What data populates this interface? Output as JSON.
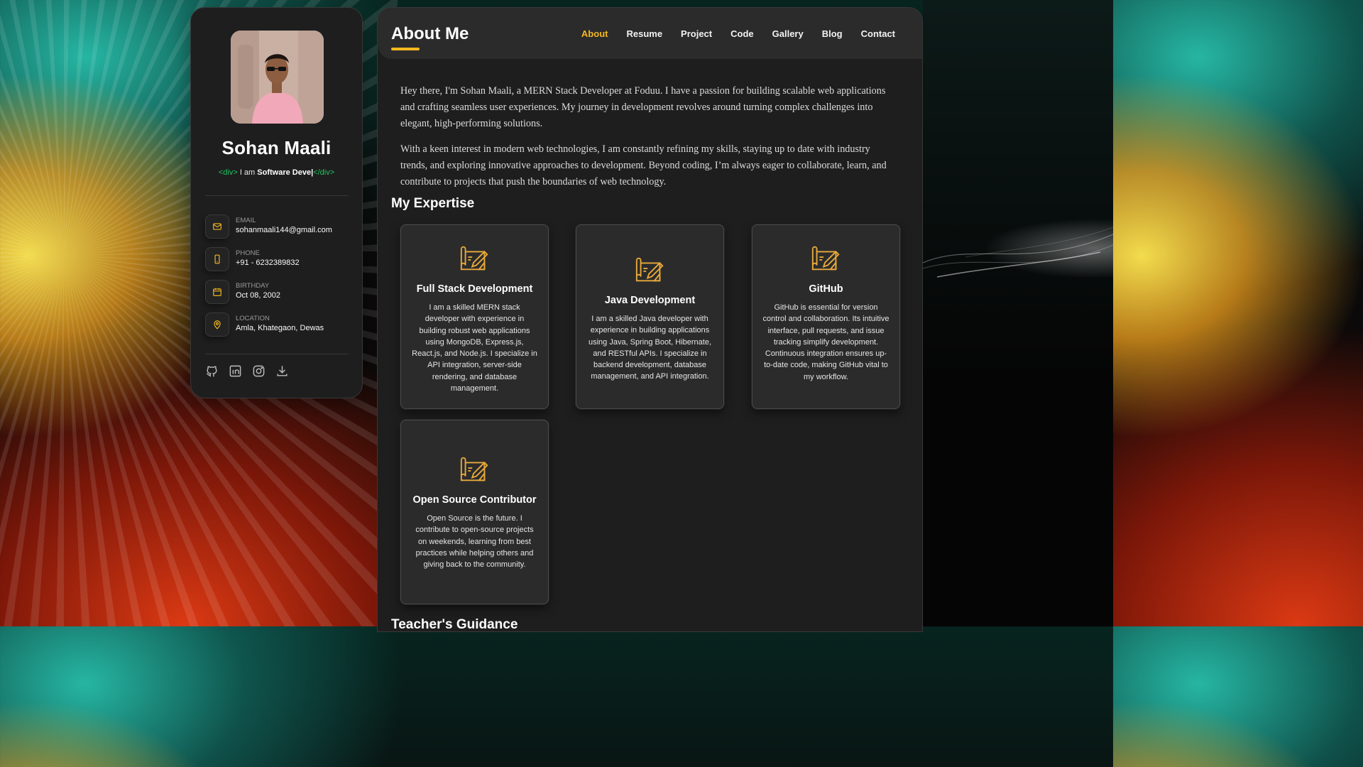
{
  "profile": {
    "name": "Sohan Maali",
    "tagline_open": "<div>",
    "tagline_prefix": " I am ",
    "tagline_role": "Software Deve|",
    "tagline_close": "</div>"
  },
  "contacts": [
    {
      "label": "EMAIL",
      "value": "sohanmaali144@gmail.com",
      "icon": "mail-icon"
    },
    {
      "label": "PHONE",
      "value": "+91 - 6232389832",
      "icon": "phone-icon"
    },
    {
      "label": "BIRTHDAY",
      "value": "Oct 08, 2002",
      "icon": "calendar-icon"
    },
    {
      "label": "LOCATION",
      "value": "Amla, Khategaon, Dewas",
      "icon": "location-pin-icon"
    }
  ],
  "socials": [
    "github-icon",
    "linkedin-icon",
    "instagram-icon",
    "download-icon"
  ],
  "header": {
    "title": "About Me",
    "nav": [
      "About",
      "Resume",
      "Project",
      "Code",
      "Gallery",
      "Blog",
      "Contact"
    ],
    "active": "About"
  },
  "about": {
    "p1": "Hey there, I'm Sohan Maali, a MERN Stack Developer at Foduu. I have a passion for building scalable web applications and crafting seamless user experiences. My journey in development revolves around turning complex challenges into elegant, high-performing solutions.",
    "p2": "With a keen interest in modern web technologies, I am constantly refining my skills, staying up to date with industry trends, and exploring innovative approaches to development. Beyond coding, I’m always eager to collaborate, learn, and contribute to projects that push the boundaries of web technology."
  },
  "expertise": {
    "title": "My Expertise",
    "cards": [
      {
        "title": "Full Stack Development",
        "text": "I am a skilled MERN stack developer with experience in building robust web applications using MongoDB, Express.js, React.js, and Node.js. I specialize in API integration, server-side rendering, and database management."
      },
      {
        "title": "Java Development",
        "text": "I am a skilled Java developer with experience in building applications using Java, Spring Boot, Hibernate, and RESTful APIs. I specialize in backend development, database management, and API integration."
      },
      {
        "title": "GitHub",
        "text": "GitHub is essential for version control and collaboration. Its intuitive interface, pull requests, and issue tracking simplify development. Continuous integration ensures up-to-date code, making GitHub vital to my workflow."
      },
      {
        "title": "Open Source Contributor",
        "text": "Open Source is the future. I contribute to open-source projects on weekends, learning from best practices while helping others and giving back to the community."
      }
    ]
  },
  "next_section": {
    "title": "Teacher's Guidance"
  },
  "colors": {
    "accent": "#f5b81f",
    "panel": "#1e1e1f",
    "tag_green": "#22c55e"
  }
}
